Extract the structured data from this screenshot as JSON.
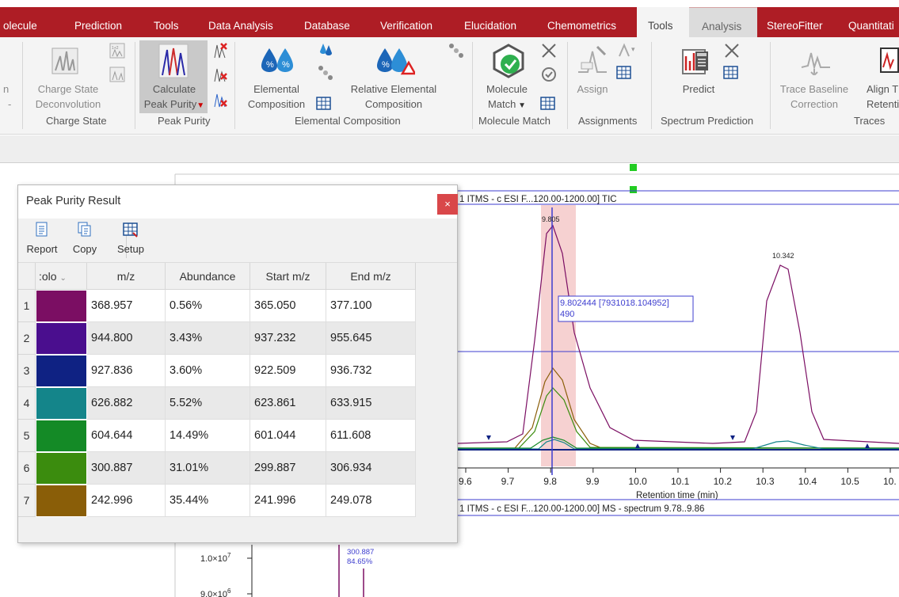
{
  "tabs": [
    {
      "label": "olecule"
    },
    {
      "label": "Prediction"
    },
    {
      "label": "Tools"
    },
    {
      "label": "Data Analysis"
    },
    {
      "label": "Database"
    },
    {
      "label": "Verification"
    },
    {
      "label": "Elucidation"
    },
    {
      "label": "Chemometrics"
    },
    {
      "label": "Tools"
    },
    {
      "label": "Analysis"
    },
    {
      "label": "StereoFitter"
    },
    {
      "label": "Quantitati"
    }
  ],
  "ribbon": {
    "cut_left": {
      "line1": "n",
      "line2": "-"
    },
    "charge_state": {
      "line1": "Charge State",
      "line2": "Deconvolution",
      "group": "Charge State"
    },
    "peak_purity": {
      "line1": "Calculate",
      "line2": "Peak Purity",
      "group": "Peak Purity"
    },
    "elemental": {
      "line1": "Elemental",
      "line2": "Composition"
    },
    "relative_elemental": {
      "line1": "Relative Elemental",
      "line2": "Composition",
      "group": "Elemental Composition"
    },
    "molecule_match": {
      "line1": "Molecule",
      "line2": "Match",
      "group": "Molecule Match"
    },
    "assign": {
      "line1": "Assign",
      "group": "Assignments"
    },
    "predict": {
      "line1": "Predict",
      "group": "Spectrum Prediction"
    },
    "trace_baseline": {
      "line1": "Trace Baseline",
      "line2": "Correction"
    },
    "align": {
      "line1": "Align T",
      "line2": "Retentio",
      "group": "Traces"
    }
  },
  "dialog": {
    "title": "Peak Purity Result",
    "close": "×",
    "toolbar": {
      "report": "Report",
      "copy": "Copy",
      "setup": "Setup"
    },
    "columns": {
      "color": ":olo",
      "mz": "m/z",
      "abundance": "Abundance",
      "start": "Start m/z",
      "end": "End m/z"
    },
    "rows": [
      {
        "n": "1",
        "color": "#7b0e63",
        "mz": "368.957",
        "abundance": "0.56%",
        "start": "365.050",
        "end": "377.100"
      },
      {
        "n": "2",
        "color": "#4a0e8e",
        "mz": "944.800",
        "abundance": "3.43%",
        "start": "937.232",
        "end": "955.645"
      },
      {
        "n": "3",
        "color": "#0f2283",
        "mz": "927.836",
        "abundance": "3.60%",
        "start": "922.509",
        "end": "936.732"
      },
      {
        "n": "4",
        "color": "#14858a",
        "mz": "626.882",
        "abundance": "5.52%",
        "start": "623.861",
        "end": "633.915"
      },
      {
        "n": "5",
        "color": "#148a26",
        "mz": "604.644",
        "abundance": "14.49%",
        "start": "601.044",
        "end": "611.608"
      },
      {
        "n": "6",
        "color": "#3b8c0e",
        "mz": "300.887",
        "abundance": "31.01%",
        "start": "299.887",
        "end": "306.934"
      },
      {
        "n": "7",
        "color": "#8a5e08",
        "mz": "242.996",
        "abundance": "35.44%",
        "start": "241.996",
        "end": "249.078"
      }
    ]
  },
  "chart": {
    "tic_title": "1 ITMS - c ESI F...120.00-1200.00] TIC",
    "ms_title": "1 ITMS - c ESI F...120.00-1200.00] MS - spectrum 9.78..9.86",
    "peak1_label": "9.805",
    "peak2_label": "10.342",
    "cursor_line1": "9.802444 [7931018.104952]",
    "cursor_line2": "490",
    "xaxis_label": "Retention time (min)",
    "xticks": [
      "9.6",
      "9.7",
      "9.8",
      "9.9",
      "10.0",
      "10.1",
      "10.2",
      "10.3",
      "10.4",
      "10.5",
      "10."
    ],
    "ms_peak_label1": "300.887",
    "ms_peak_label2": "84.65%",
    "ms_ytick1_base": "1.0×10",
    "ms_ytick1_exp": "7",
    "ms_ytick2_base": "9.0×10",
    "ms_ytick2_exp": "6"
  },
  "colors": {
    "ribbon_tab": "#ae1d25",
    "close": "#d9474a",
    "cursor": "#3d3dcf",
    "highlight": "#f5c9c9"
  }
}
